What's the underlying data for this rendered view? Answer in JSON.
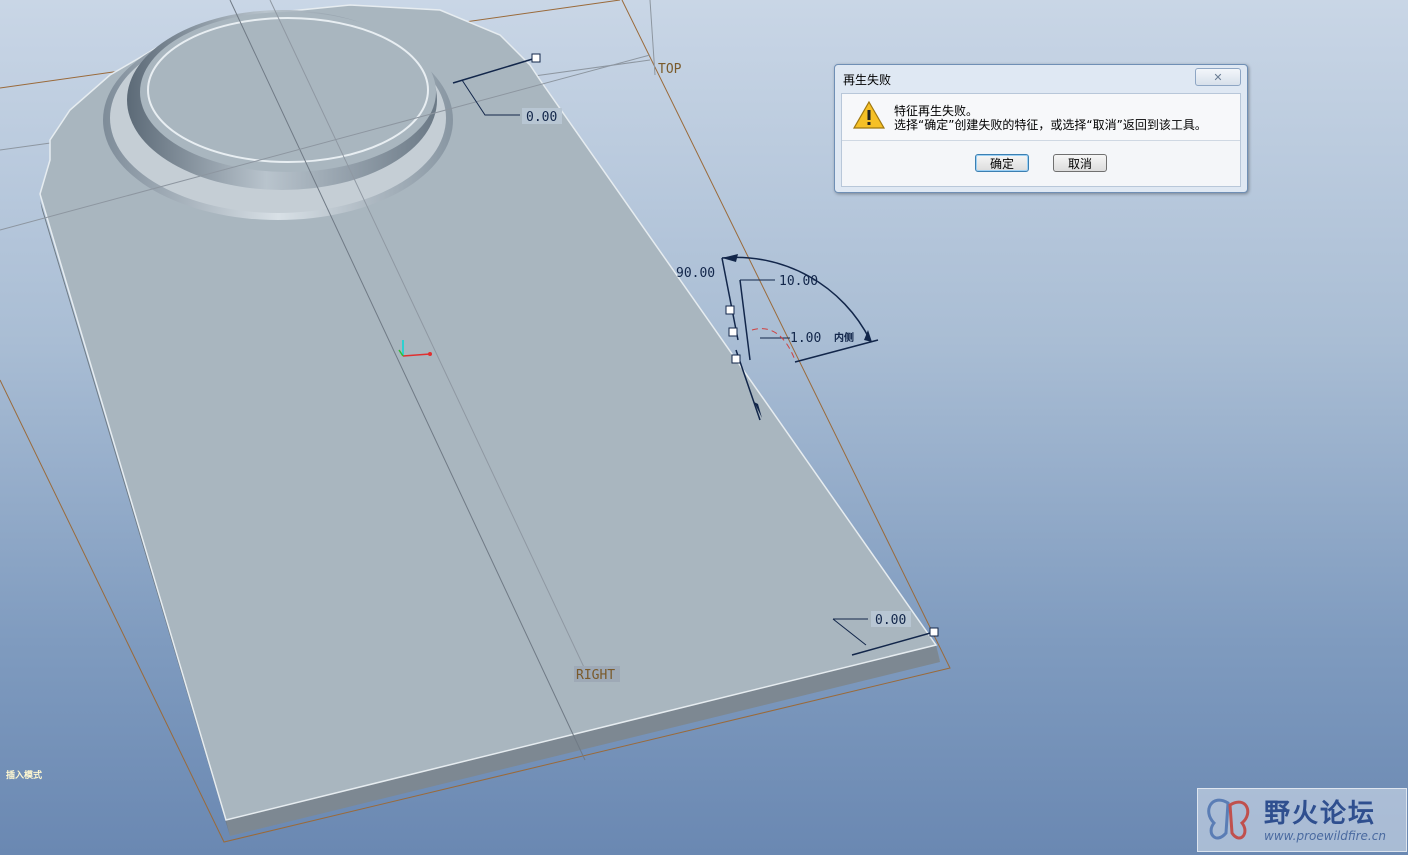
{
  "viewport": {
    "datum_top": "TOP",
    "datum_right": "RIGHT",
    "dimensions": {
      "top_offset": "0.00",
      "angle": "90.00",
      "length": "10.00",
      "thickness": "1.00",
      "side": "内侧",
      "bottom_offset": "0.00"
    },
    "mode_label": "插入模式"
  },
  "dialog": {
    "title": "再生失败",
    "close_symbol": "✕",
    "message_line1": "特征再生失败。",
    "message_line2": "选择“确定”创建失败的特征，或选择“取消”返回到该工具。",
    "ok_label": "确定",
    "cancel_label": "取消"
  },
  "watermark": {
    "name": "野火论坛",
    "url": "www.proewildfire.cn"
  },
  "colors": {
    "part_face": "#a9b6bf",
    "datum_plane": "#9a6a3a",
    "dimension": "#12264a"
  }
}
